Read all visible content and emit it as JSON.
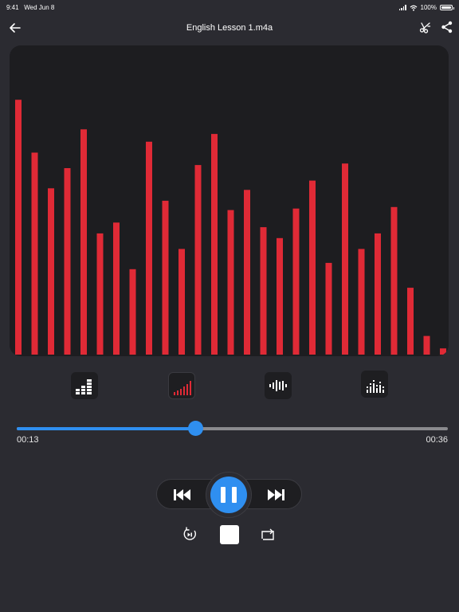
{
  "status_bar": {
    "time": "9:41",
    "date": "Wed Jun 8",
    "battery": "100%"
  },
  "nav": {
    "back_icon": "arrow-left-icon",
    "title": "English Lesson 1.m4a",
    "cut_icon": "scissors-icon",
    "share_icon": "share-icon"
  },
  "visualizer": {
    "bar_color": "#e02a36",
    "bar_levels": [
      0.82,
      0.65,
      0.535,
      0.6,
      0.725,
      0.39,
      0.425,
      0.275,
      0.685,
      0.495,
      0.34,
      0.61,
      0.71,
      0.465,
      0.53,
      0.41,
      0.375,
      0.47,
      0.56,
      0.295,
      0.615,
      0.34,
      0.39,
      0.475,
      0.215,
      0.06,
      0.02
    ]
  },
  "modes": [
    {
      "name": "mode-blocks",
      "icon": "equalizer-blocks-icon"
    },
    {
      "name": "mode-bars",
      "icon": "rising-bars-icon",
      "active": true
    },
    {
      "name": "mode-wave",
      "icon": "waveform-icon"
    },
    {
      "name": "mode-dots",
      "icon": "dotted-spectrum-icon"
    }
  ],
  "playback": {
    "current_time": "00:13",
    "total_time": "00:36",
    "progress": 0.415,
    "accent_color": "#2f8ff0"
  },
  "controls": {
    "previous_icon": "skip-back-icon",
    "play_pause_icon": "pause-icon",
    "next_icon": "skip-forward-icon",
    "speed_icon": "rewind-circle-icon",
    "stop_icon": "stop-icon",
    "repeat_icon": "repeat-icon"
  }
}
